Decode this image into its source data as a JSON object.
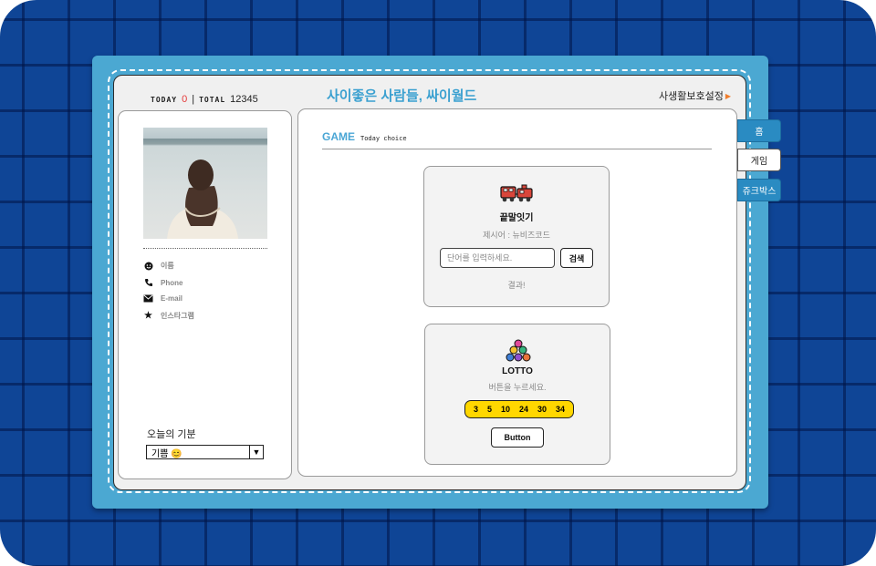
{
  "header": {
    "today_label": "TODAY",
    "today_count": "0",
    "separator": "|",
    "total_label": "TOTAL",
    "total_count": "12345",
    "site_title": "사이좋은 사람들, 싸이월드",
    "privacy_link": "사생활보호설정",
    "privacy_arrow_icon": "triangle-right-icon"
  },
  "profile": {
    "info": [
      {
        "icon": "smiley-icon",
        "label": "이름"
      },
      {
        "icon": "phone-icon",
        "label": "Phone"
      },
      {
        "icon": "mail-icon",
        "label": "E-mail"
      },
      {
        "icon": "star-icon",
        "label": "인스타그램"
      }
    ],
    "mood_label": "오늘의 기분",
    "mood_value": "기쁨 😊"
  },
  "main": {
    "title": "GAME",
    "subtitle": "Today choice",
    "word_game": {
      "title": "끝말잇기",
      "prompt": "제시어 : 뉴비즈코드",
      "input_placeholder": "단어를 입력하세요.",
      "search_button": "검색",
      "result": "결과!"
    },
    "lotto": {
      "title": "LOTTO",
      "instruction": "버튼을 누르세요.",
      "numbers": [
        "3",
        "5",
        "10",
        "24",
        "30",
        "34"
      ],
      "button": "Button"
    }
  },
  "tabs": [
    {
      "label": "홈",
      "state": "active"
    },
    {
      "label": "게임",
      "state": "inactive"
    },
    {
      "label": "쥬크박스",
      "state": "active"
    }
  ],
  "colors": {
    "background": "#0f4596",
    "cover": "#4ba8d2",
    "accent": "#4aa6d5",
    "lotto_ball": "#ffd700"
  }
}
